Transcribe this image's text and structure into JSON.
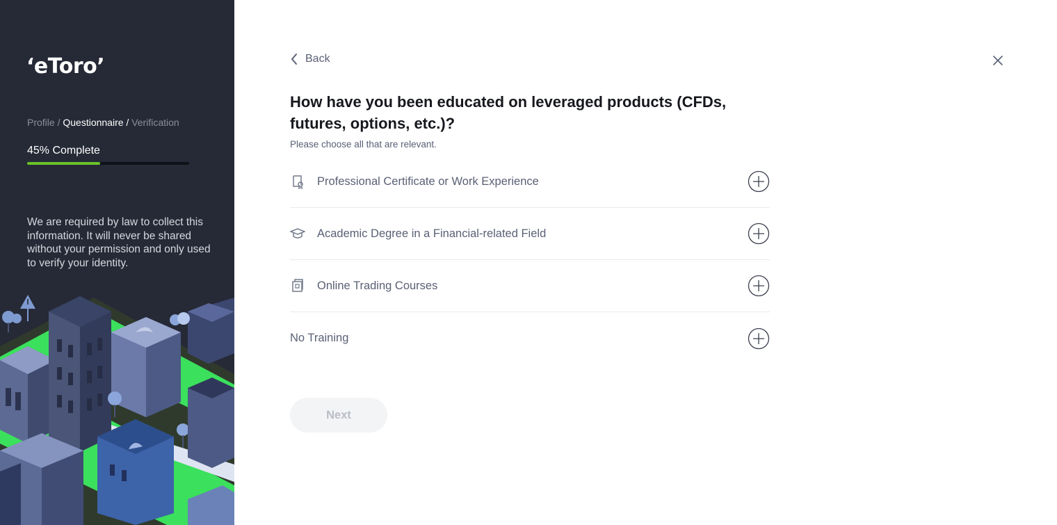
{
  "brand": {
    "logo_text": "‘eToro’"
  },
  "sidebar": {
    "breadcrumb": [
      {
        "label": "Profile /",
        "active": false
      },
      {
        "label": "Questionnaire /",
        "active": true
      },
      {
        "label": "Verification",
        "active": false
      }
    ],
    "progress": {
      "label": "45% Complete",
      "percent": 45,
      "fill_color": "#6ac32a"
    },
    "legal_text": "We are required by law to collect this information. It will never be shared without your permission and only used to verify your identity."
  },
  "nav": {
    "back_label": "Back"
  },
  "question": {
    "title": "How have you been educated on leveraged products (CFDs, futures, options, etc.)?",
    "hint": "Please choose all that are relevant.",
    "options": [
      {
        "label": "Professional Certificate or Work Experience",
        "icon": "certificate-icon"
      },
      {
        "label": "Academic Degree in a Financial-related Field",
        "icon": "graduation-cap-icon"
      },
      {
        "label": "Online Trading Courses",
        "icon": "course-book-icon"
      },
      {
        "label": "No Training",
        "icon": ""
      }
    ]
  },
  "actions": {
    "next_label": "Next"
  },
  "colors": {
    "sidebar_bg": "#262a36",
    "accent_green": "#6ac32a",
    "text_muted": "#5a6075"
  }
}
